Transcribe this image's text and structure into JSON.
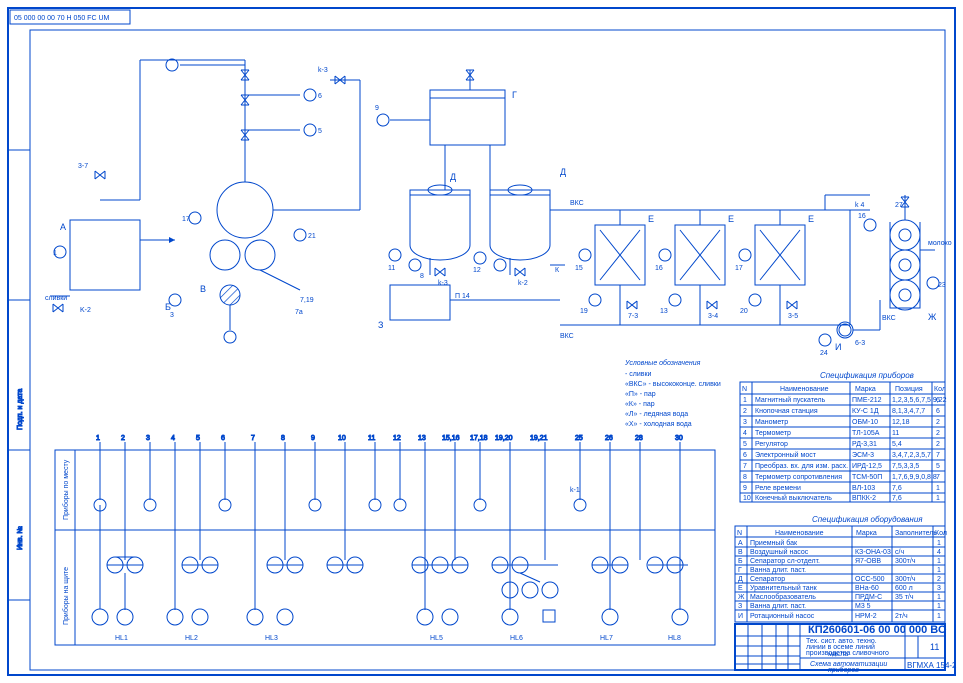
{
  "drawing_number_top": "05 000 00 00 70 H 050 FC UM",
  "labels": {
    "A": "A",
    "B": "Б",
    "V": "В",
    "G": "Г",
    "D1": "Д",
    "D2": "Д",
    "E1": "Е",
    "E2": "Е",
    "E3": "Е",
    "Zh": "Ж",
    "Z": "З",
    "I": "И"
  },
  "tags": {
    "slivki": "сливки",
    "bks_top": "ВКС",
    "bks_bottom": "ВКС",
    "bks_right": "ВКС",
    "slivki_small": ">< сливки",
    "moloko": "молоко"
  },
  "legend": {
    "title": "Условные обозначения",
    "l1": "- сливки",
    "l2": "«ВКС» - высококонце. сливки",
    "l3": "«П» - пар",
    "l4": "«К» - пар",
    "l5": "«Л» - ледяная вода",
    "l6": "«Х» - холодная вода"
  },
  "instr_table": {
    "title": "Спецификация приборов",
    "headers": [
      "Наименование",
      "Марка",
      "Позиция",
      "Кол"
    ],
    "rows": [
      [
        "1",
        "Магнитный пускатель",
        "ПМЕ-212",
        "1,2,3,5,6,7,5,9,22",
        "6"
      ],
      [
        "2",
        "Кнопочная станция",
        "КУ-С 1Д",
        "8,1,3,4,7,7",
        "6"
      ],
      [
        "3",
        "Манометр",
        "ОБМ-10",
        "12,18",
        "2"
      ],
      [
        "4",
        "Термометр",
        "ТЛ-105А",
        "11",
        "2"
      ],
      [
        "5",
        "Регулятор",
        "РД-3,31",
        "5,4",
        "2"
      ],
      [
        "6",
        "Электронный мост",
        "ЭСМ-3",
        "3,4,7,2,3,5,7",
        "7"
      ],
      [
        "7",
        "Преобраз. вх. для изм. расх.",
        "ИРД-12,5",
        "7,5,3,3,5",
        "5"
      ],
      [
        "8",
        "Термометр сопротивления",
        "ТСМ-50П",
        "1,7,6,9,9,0,8,8",
        "7"
      ],
      [
        "9",
        "Реле времени",
        "ВЛ-103",
        "7,6",
        "1"
      ],
      [
        "10",
        "Конечный выключатель",
        "ВПКК-2",
        "7,6",
        "1"
      ]
    ]
  },
  "equip_table": {
    "title": "Спецификация оборудования",
    "headers": [
      "Наименование",
      "Марка",
      "Заполнитель",
      "Кол"
    ],
    "rows": [
      [
        "A",
        "Приемный бак",
        "",
        "",
        "1"
      ],
      [
        "В",
        "Воздушный насос",
        "КЗ-ОНА-03",
        "с/ч",
        "4"
      ],
      [
        "Б",
        "Сепаратор сл-отделт.",
        "Я7-ОВВ",
        "300т/ч",
        "1"
      ],
      [
        "Г",
        "Ванна длит. паст.",
        "",
        "",
        "1"
      ],
      [
        "Д",
        "Сепаратор",
        "ОСС-500",
        "300т/ч",
        "2"
      ],
      [
        "Е",
        "Уравнительный танк",
        "ВНа-60",
        "600 л",
        "3"
      ],
      [
        "Ж",
        "Маслообразователь",
        "ПРДМ-С",
        "35 т/ч",
        "1"
      ],
      [
        "З",
        "Ванна длит. паст.",
        "М3 5",
        "",
        "1"
      ],
      [
        "И",
        "Ротационный насос",
        "НРМ-2",
        "2т/ч",
        "1"
      ]
    ]
  },
  "title_block": {
    "main": "КП260601-06 00 00 000 ВО",
    "desc1": "Тех. сист. авто. техно.",
    "desc2": "линии в осеме линий",
    "desc3": "производства сливочного",
    "desc4": "масла",
    "sub": "Схема автоматизации",
    "sub2": "приборов",
    "sheet": "11",
    "org": "ВГМХА 154-2"
  },
  "panel": {
    "top_label": "Приборы по  месту",
    "bot_label": "Приборы  на  щите",
    "bottom_tags": [
      "HL1",
      "HL2",
      "HL3",
      "",
      "HL5",
      "HL6",
      "HL7",
      "HL8"
    ]
  },
  "small_nums": [
    "1",
    "2",
    "3",
    "4",
    "5",
    "6",
    "7",
    "8",
    "9",
    "10",
    "11",
    "12",
    "13",
    "15",
    "16",
    "17",
    "18",
    "19",
    "20",
    "21",
    "22",
    "23",
    "19,20",
    "19,21"
  ]
}
